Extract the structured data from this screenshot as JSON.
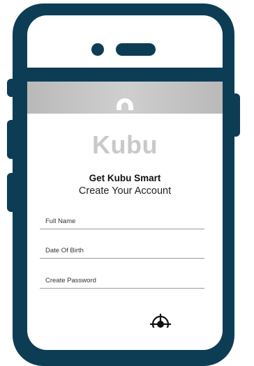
{
  "brand": {
    "name": "Kubu"
  },
  "heading": {
    "title": "Get Kubu Smart",
    "subtitle": "Create Your Account"
  },
  "form": {
    "full_name": {
      "placeholder": "Full Name",
      "value": ""
    },
    "date_of_birth": {
      "placeholder": "Date Of Birth",
      "value": ""
    },
    "password": {
      "placeholder": "Create Password",
      "value": ""
    }
  },
  "icons": {
    "header_logo": "kubu-logo-icon",
    "bottom": "crosshair-icon"
  },
  "colors": {
    "frame": "#0d3d55",
    "header_band": "#c4c4c4",
    "brand_text": "#c9c9c9"
  }
}
